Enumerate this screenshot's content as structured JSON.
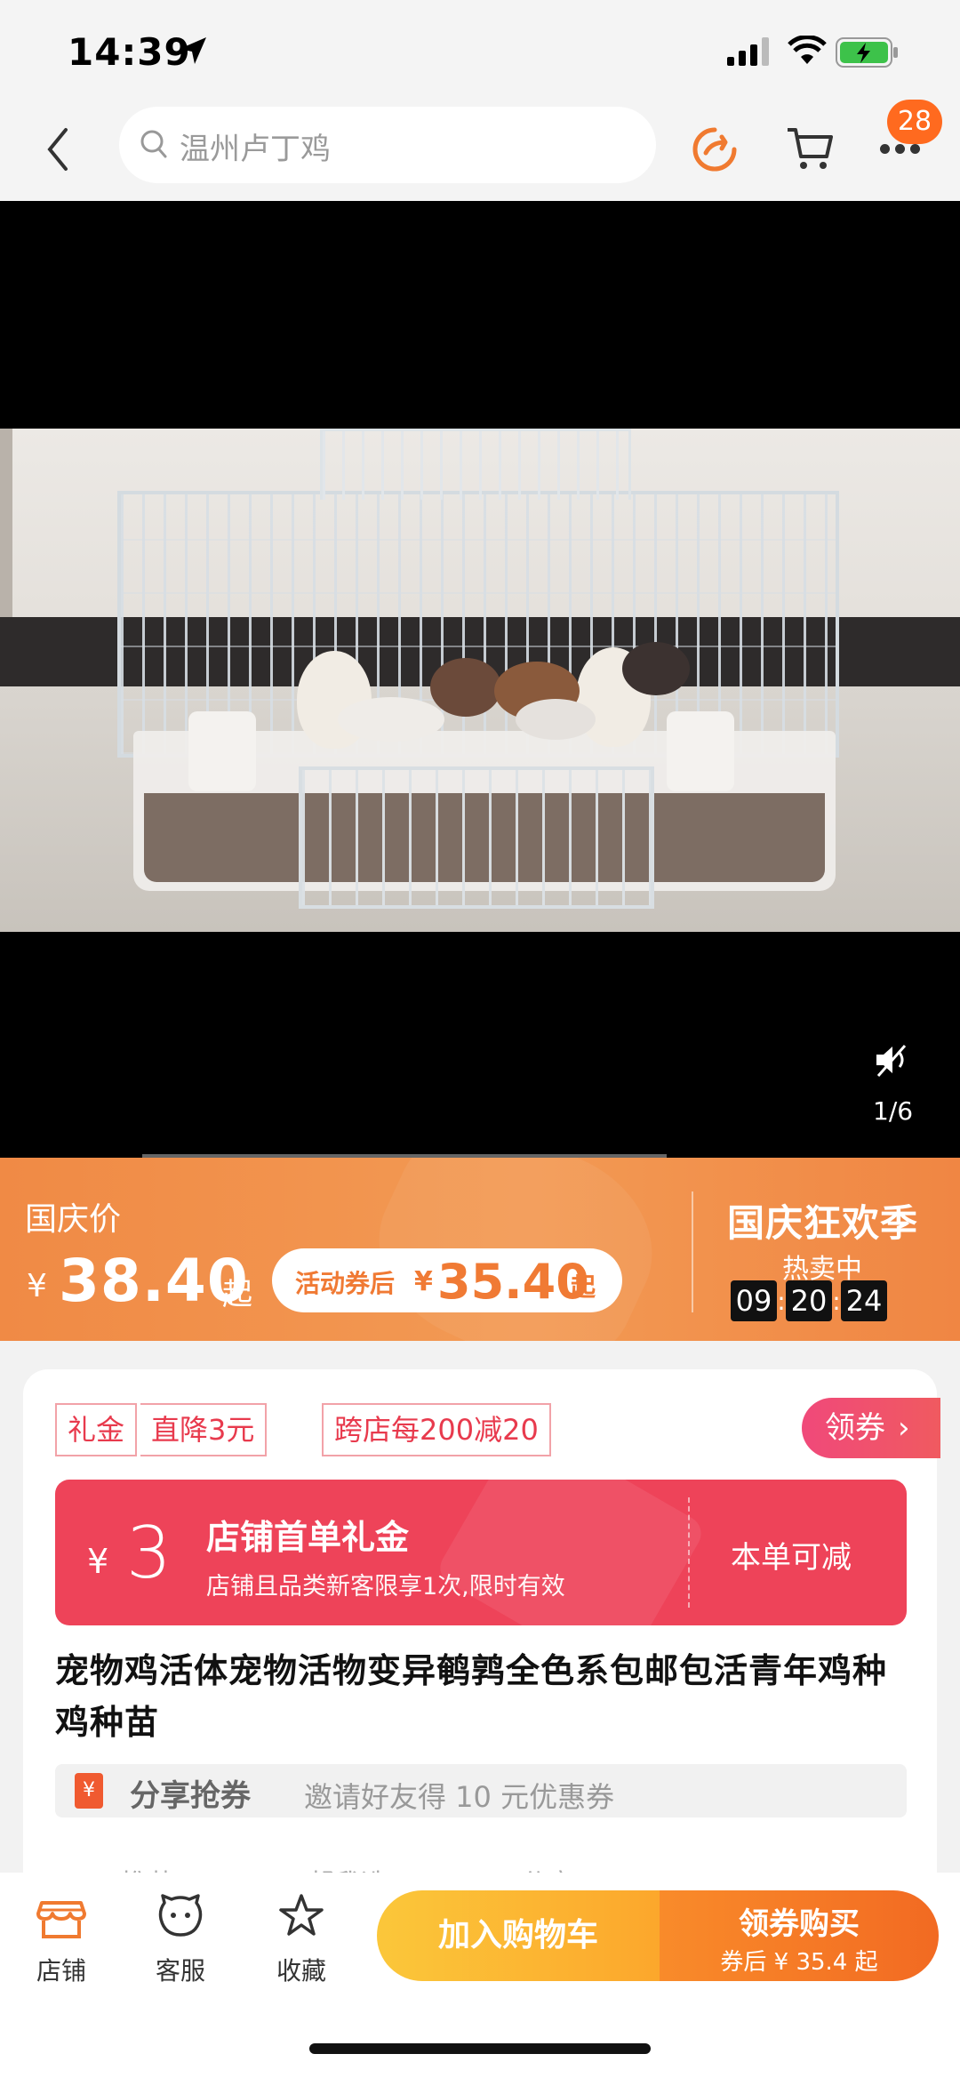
{
  "status_bar": {
    "time": "14:39"
  },
  "nav": {
    "search_placeholder": "温州卢丁鸡",
    "cart_badge": "28"
  },
  "media": {
    "pager": "1/6"
  },
  "price": {
    "label": "国庆价",
    "currency": "¥",
    "amount": "38.40",
    "from_suffix": "起",
    "coupon_prefix": "活动券后",
    "coupon_currency": "¥",
    "coupon_amount": "35.40",
    "coupon_suffix": "起",
    "festival": "国庆狂欢季",
    "hot": "热卖中",
    "timer": {
      "h": "09",
      "m": "20",
      "s": "24"
    }
  },
  "tags": [
    "礼金",
    "直降3元",
    "跨店每200减20"
  ],
  "get_coupon": "领券",
  "gift": {
    "currency": "¥",
    "amount": "3",
    "title": "店铺首单礼金",
    "subtitle": "店铺且品类新客限享1次,限时有效",
    "right": "本单可减"
  },
  "product_title": "宠物鸡活体宠物活物变异鹌鹑全色系包邮包活青年鸡种鸡种苗",
  "share_bar": {
    "icon_text": "¥",
    "label": "分享抢券",
    "desc": "邀请好友得 10 元优惠券"
  },
  "partial_row": [
    "推荐",
    "帮我选",
    "分享"
  ],
  "bottom_bar": {
    "store": "店铺",
    "service": "客服",
    "favorite": "收藏",
    "add_cart": "加入购物车",
    "buy_title": "领券购买",
    "buy_sub": "券后 ¥ 35.4 起"
  },
  "colors": {
    "accent_orange": "#f39a54",
    "coupon_red": "#ee4359",
    "cart_yellow": "#fbc73a",
    "buy_orange": "#f26a22"
  }
}
